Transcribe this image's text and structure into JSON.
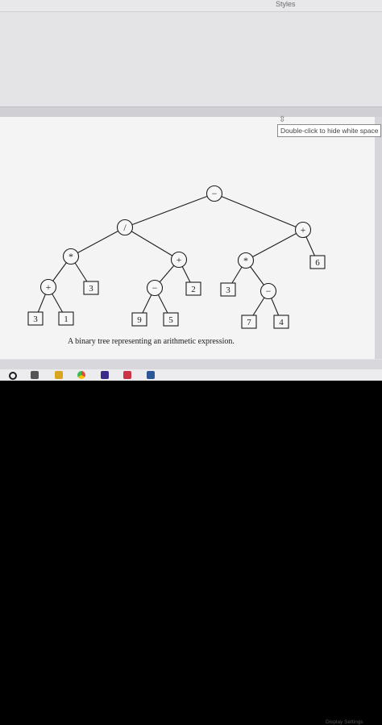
{
  "ribbon": {
    "styles_label": "Styles"
  },
  "document": {
    "hide_whitespace_tooltip": "Double-click to hide white space",
    "figure": {
      "caption": "A binary tree representing an arithmetic expression.",
      "tree": {
        "root": "−",
        "nodes": [
          {
            "id": "n1",
            "label": "−",
            "shape": "circle"
          },
          {
            "id": "n2",
            "label": "/",
            "shape": "circle"
          },
          {
            "id": "n3",
            "label": "+",
            "shape": "circle"
          },
          {
            "id": "n4",
            "label": "*",
            "shape": "circle"
          },
          {
            "id": "n5",
            "label": "+",
            "shape": "circle"
          },
          {
            "id": "n6",
            "label": "*",
            "shape": "circle"
          },
          {
            "id": "n7",
            "label": "6",
            "shape": "square"
          },
          {
            "id": "n8",
            "label": "+",
            "shape": "circle"
          },
          {
            "id": "n9",
            "label": "3",
            "shape": "square"
          },
          {
            "id": "n10",
            "label": "−",
            "shape": "circle"
          },
          {
            "id": "n11",
            "label": "2",
            "shape": "square"
          },
          {
            "id": "n12",
            "label": "3",
            "shape": "square"
          },
          {
            "id": "n13",
            "label": "−",
            "shape": "circle"
          },
          {
            "id": "n14",
            "label": "3",
            "shape": "square"
          },
          {
            "id": "n15",
            "label": "1",
            "shape": "square"
          },
          {
            "id": "n16",
            "label": "9",
            "shape": "square"
          },
          {
            "id": "n17",
            "label": "5",
            "shape": "square"
          },
          {
            "id": "n18",
            "label": "7",
            "shape": "square"
          },
          {
            "id": "n19",
            "label": "4",
            "shape": "square"
          }
        ],
        "edges": [
          [
            "n1",
            "n2"
          ],
          [
            "n1",
            "n3"
          ],
          [
            "n2",
            "n4"
          ],
          [
            "n2",
            "n5"
          ],
          [
            "n3",
            "n6"
          ],
          [
            "n3",
            "n7"
          ],
          [
            "n4",
            "n8"
          ],
          [
            "n4",
            "n9"
          ],
          [
            "n5",
            "n10"
          ],
          [
            "n5",
            "n11"
          ],
          [
            "n6",
            "n12"
          ],
          [
            "n6",
            "n13"
          ],
          [
            "n8",
            "n14"
          ],
          [
            "n8",
            "n15"
          ],
          [
            "n10",
            "n16"
          ],
          [
            "n10",
            "n17"
          ],
          [
            "n13",
            "n18"
          ],
          [
            "n13",
            "n19"
          ]
        ]
      }
    }
  },
  "status_bar": {
    "display_settings": "Display Settings"
  },
  "taskbar": {
    "icons": [
      {
        "name": "search-circle-icon",
        "color": "#1b1b1b"
      },
      {
        "name": "task-view-icon",
        "color": "#555555"
      },
      {
        "name": "file-explorer-icon",
        "color": "#d9a520"
      },
      {
        "name": "chrome-icon",
        "color": "#dd4b39"
      },
      {
        "name": "app-purple-icon",
        "color": "#3a2a8c"
      },
      {
        "name": "snip-tool-icon",
        "color": "#cc3344"
      },
      {
        "name": "word-icon",
        "color": "#2b5797"
      }
    ]
  }
}
